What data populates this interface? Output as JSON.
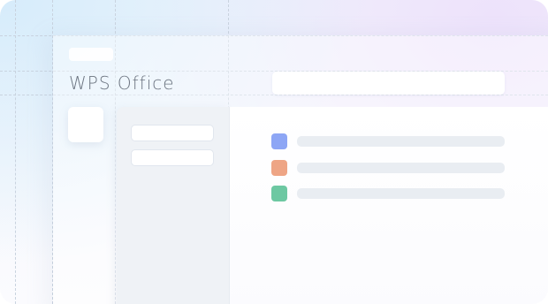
{
  "app": {
    "logo_text": "WPS Office"
  },
  "file_list": {
    "icon_colors": [
      "#8da6f5",
      "#eea585",
      "#6dc8a2"
    ]
  }
}
